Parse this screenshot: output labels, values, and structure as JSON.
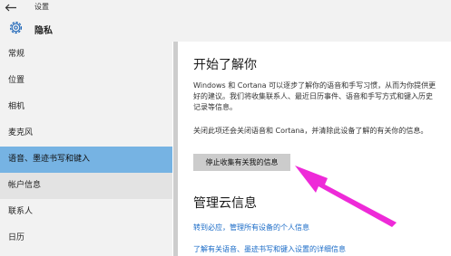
{
  "window": {
    "title": "设置"
  },
  "header": {
    "title": "隐私",
    "icon": "gear-icon"
  },
  "sidebar": {
    "items": [
      {
        "label": "常规"
      },
      {
        "label": "位置"
      },
      {
        "label": "相机"
      },
      {
        "label": "麦克风"
      },
      {
        "label": "语音、墨迹书写和键入",
        "selected": true
      },
      {
        "label": "帐户信息"
      },
      {
        "label": "联系人"
      },
      {
        "label": "日历"
      }
    ]
  },
  "main": {
    "heading": "开始了解你",
    "paragraph1": "Windows 和 Cortana 可以逐步了解你的语音和手写习惯，从而为你提供更好的建议。我们将收集联系人、最近日历事件、语音和手写方式和键入历史记录等信息。",
    "paragraph2": "关闭此项还会关闭语音和 Cortana，并清除此设备了解的有关你的信息。",
    "stop_button": "停止收集有关我的信息",
    "cloud_heading": "管理云信息",
    "link1": "转到必应，管理所有设备的个人信息",
    "link2": "了解有关语音、墨迹书写和键入设置的详细信息"
  },
  "colors": {
    "selected": "#76b3e3",
    "link": "#1a6bc7",
    "annotation_arrow": "#ee2ad8"
  }
}
